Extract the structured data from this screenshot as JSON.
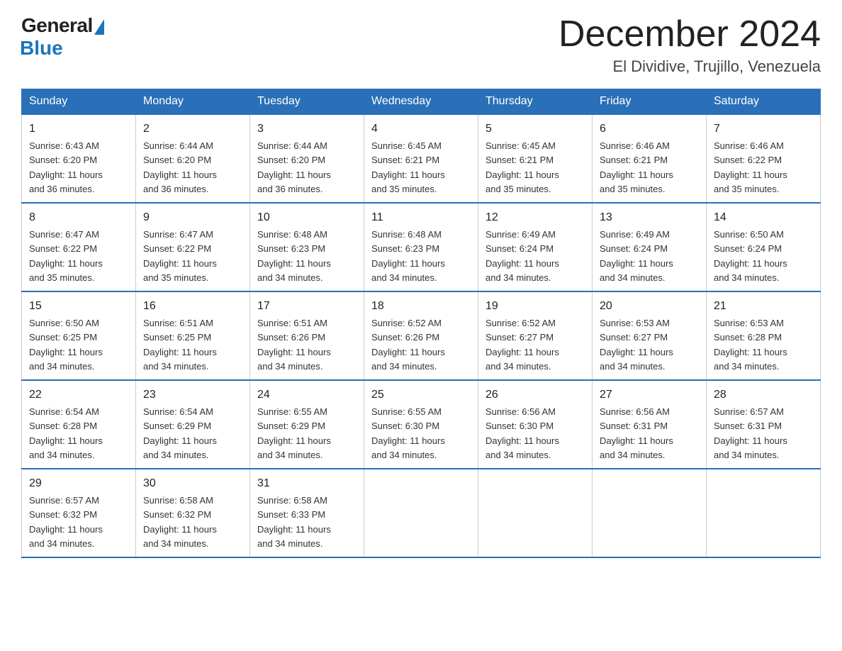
{
  "logo": {
    "general": "General",
    "blue": "Blue"
  },
  "title": "December 2024",
  "subtitle": "El Dividive, Trujillo, Venezuela",
  "days_of_week": [
    "Sunday",
    "Monday",
    "Tuesday",
    "Wednesday",
    "Thursday",
    "Friday",
    "Saturday"
  ],
  "weeks": [
    [
      {
        "day": "1",
        "sunrise": "6:43 AM",
        "sunset": "6:20 PM",
        "daylight": "11 hours and 36 minutes."
      },
      {
        "day": "2",
        "sunrise": "6:44 AM",
        "sunset": "6:20 PM",
        "daylight": "11 hours and 36 minutes."
      },
      {
        "day": "3",
        "sunrise": "6:44 AM",
        "sunset": "6:20 PM",
        "daylight": "11 hours and 36 minutes."
      },
      {
        "day": "4",
        "sunrise": "6:45 AM",
        "sunset": "6:21 PM",
        "daylight": "11 hours and 35 minutes."
      },
      {
        "day": "5",
        "sunrise": "6:45 AM",
        "sunset": "6:21 PM",
        "daylight": "11 hours and 35 minutes."
      },
      {
        "day": "6",
        "sunrise": "6:46 AM",
        "sunset": "6:21 PM",
        "daylight": "11 hours and 35 minutes."
      },
      {
        "day": "7",
        "sunrise": "6:46 AM",
        "sunset": "6:22 PM",
        "daylight": "11 hours and 35 minutes."
      }
    ],
    [
      {
        "day": "8",
        "sunrise": "6:47 AM",
        "sunset": "6:22 PM",
        "daylight": "11 hours and 35 minutes."
      },
      {
        "day": "9",
        "sunrise": "6:47 AM",
        "sunset": "6:22 PM",
        "daylight": "11 hours and 35 minutes."
      },
      {
        "day": "10",
        "sunrise": "6:48 AM",
        "sunset": "6:23 PM",
        "daylight": "11 hours and 34 minutes."
      },
      {
        "day": "11",
        "sunrise": "6:48 AM",
        "sunset": "6:23 PM",
        "daylight": "11 hours and 34 minutes."
      },
      {
        "day": "12",
        "sunrise": "6:49 AM",
        "sunset": "6:24 PM",
        "daylight": "11 hours and 34 minutes."
      },
      {
        "day": "13",
        "sunrise": "6:49 AM",
        "sunset": "6:24 PM",
        "daylight": "11 hours and 34 minutes."
      },
      {
        "day": "14",
        "sunrise": "6:50 AM",
        "sunset": "6:24 PM",
        "daylight": "11 hours and 34 minutes."
      }
    ],
    [
      {
        "day": "15",
        "sunrise": "6:50 AM",
        "sunset": "6:25 PM",
        "daylight": "11 hours and 34 minutes."
      },
      {
        "day": "16",
        "sunrise": "6:51 AM",
        "sunset": "6:25 PM",
        "daylight": "11 hours and 34 minutes."
      },
      {
        "day": "17",
        "sunrise": "6:51 AM",
        "sunset": "6:26 PM",
        "daylight": "11 hours and 34 minutes."
      },
      {
        "day": "18",
        "sunrise": "6:52 AM",
        "sunset": "6:26 PM",
        "daylight": "11 hours and 34 minutes."
      },
      {
        "day": "19",
        "sunrise": "6:52 AM",
        "sunset": "6:27 PM",
        "daylight": "11 hours and 34 minutes."
      },
      {
        "day": "20",
        "sunrise": "6:53 AM",
        "sunset": "6:27 PM",
        "daylight": "11 hours and 34 minutes."
      },
      {
        "day": "21",
        "sunrise": "6:53 AM",
        "sunset": "6:28 PM",
        "daylight": "11 hours and 34 minutes."
      }
    ],
    [
      {
        "day": "22",
        "sunrise": "6:54 AM",
        "sunset": "6:28 PM",
        "daylight": "11 hours and 34 minutes."
      },
      {
        "day": "23",
        "sunrise": "6:54 AM",
        "sunset": "6:29 PM",
        "daylight": "11 hours and 34 minutes."
      },
      {
        "day": "24",
        "sunrise": "6:55 AM",
        "sunset": "6:29 PM",
        "daylight": "11 hours and 34 minutes."
      },
      {
        "day": "25",
        "sunrise": "6:55 AM",
        "sunset": "6:30 PM",
        "daylight": "11 hours and 34 minutes."
      },
      {
        "day": "26",
        "sunrise": "6:56 AM",
        "sunset": "6:30 PM",
        "daylight": "11 hours and 34 minutes."
      },
      {
        "day": "27",
        "sunrise": "6:56 AM",
        "sunset": "6:31 PM",
        "daylight": "11 hours and 34 minutes."
      },
      {
        "day": "28",
        "sunrise": "6:57 AM",
        "sunset": "6:31 PM",
        "daylight": "11 hours and 34 minutes."
      }
    ],
    [
      {
        "day": "29",
        "sunrise": "6:57 AM",
        "sunset": "6:32 PM",
        "daylight": "11 hours and 34 minutes."
      },
      {
        "day": "30",
        "sunrise": "6:58 AM",
        "sunset": "6:32 PM",
        "daylight": "11 hours and 34 minutes."
      },
      {
        "day": "31",
        "sunrise": "6:58 AM",
        "sunset": "6:33 PM",
        "daylight": "11 hours and 34 minutes."
      },
      null,
      null,
      null,
      null
    ]
  ],
  "labels": {
    "sunrise": "Sunrise:",
    "sunset": "Sunset:",
    "daylight": "Daylight:"
  }
}
